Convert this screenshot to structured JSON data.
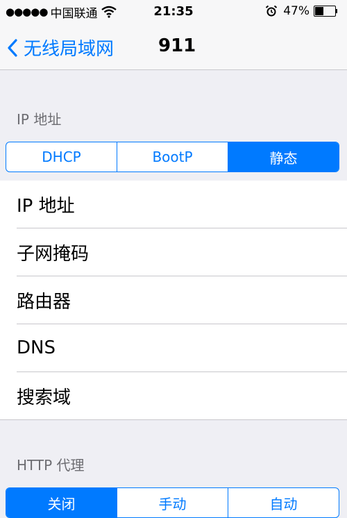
{
  "status_bar": {
    "signal": "●●●●●",
    "carrier": "中国联通",
    "time": "21:35",
    "battery_percent": "47%",
    "battery_level": 0.47
  },
  "nav": {
    "back_label": "无线局域网",
    "title": "911"
  },
  "ip_section": {
    "header": "IP 地址",
    "segments": [
      {
        "label": "DHCP",
        "selected": false
      },
      {
        "label": "BootP",
        "selected": false
      },
      {
        "label": "静态",
        "selected": true
      }
    ],
    "fields": [
      {
        "label": "IP 地址"
      },
      {
        "label": "子网掩码"
      },
      {
        "label": "路由器"
      },
      {
        "label": "DNS"
      },
      {
        "label": "搜索域"
      }
    ]
  },
  "proxy_section": {
    "header": "HTTP 代理",
    "segments": [
      {
        "label": "关闭",
        "selected": true
      },
      {
        "label": "手动",
        "selected": false
      },
      {
        "label": "自动",
        "selected": false
      }
    ]
  },
  "colors": {
    "accent": "#007aff",
    "background": "#efeff4",
    "separator": "#c8c7cc",
    "section_text": "#6d6d72"
  }
}
